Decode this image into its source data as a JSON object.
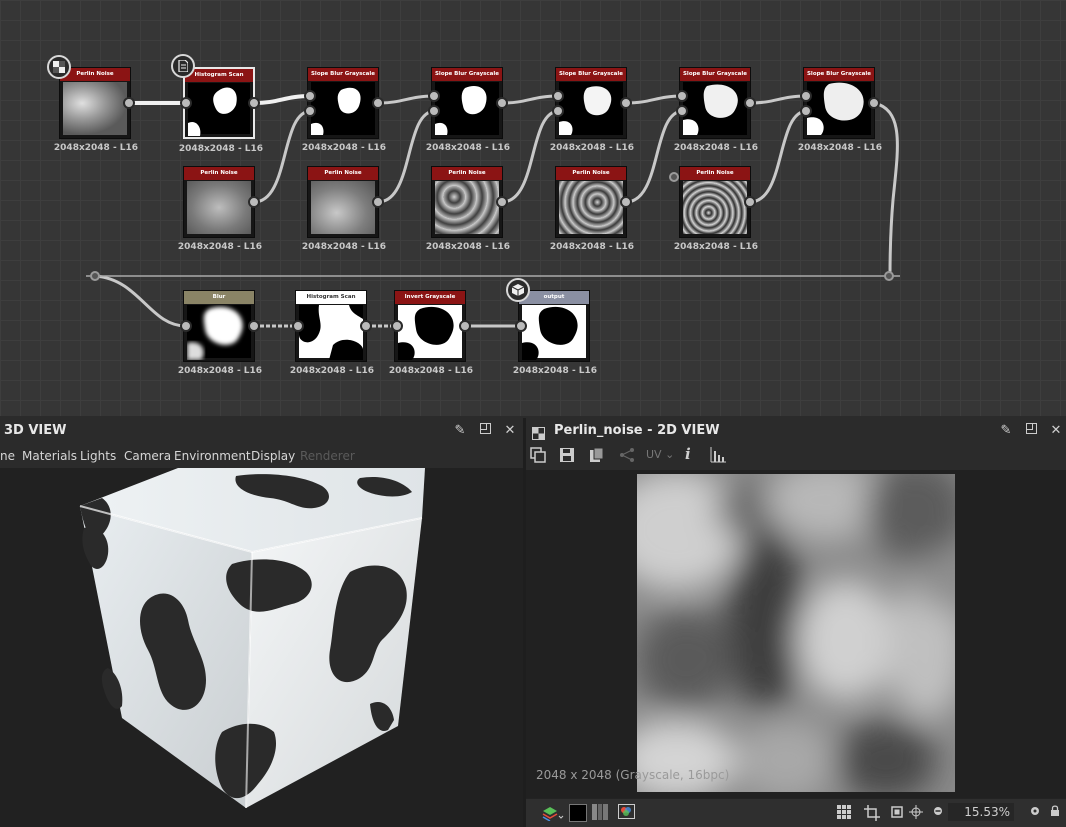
{
  "graph": {
    "res": "2048x2048 - L16",
    "nodes": {
      "perlin_main": "Perlin Noise",
      "hist1": "Histogram Scan",
      "slope1": "Slope Blur Grayscale",
      "slope2": "Slope Blur Grayscale",
      "slope3": "Slope Blur Grayscale",
      "slope4": "Slope Blur Grayscale",
      "slope5": "Slope Blur Grayscale",
      "perlin1": "Perlin Noise",
      "perlin2": "Perlin Noise",
      "perlin3": "Perlin Noise",
      "perlin4": "Perlin Noise",
      "perlin5": "Perlin Noise",
      "blur": "Blur",
      "hist2": "Histogram Scan",
      "invert": "Invert Grayscale",
      "output": "output"
    },
    "colors": {
      "header_red": "#8b1414",
      "header_blur": "#8a8466",
      "header_output": "#8a8fa2"
    }
  },
  "view3d": {
    "title": "3D VIEW",
    "menu": [
      "ne",
      "Materials",
      "Lights",
      "Camera",
      "Environment",
      "Display",
      "Renderer"
    ],
    "icons": [
      "pin-icon",
      "maximize-icon",
      "close-icon"
    ]
  },
  "view2d": {
    "title": "Perlin_noise - 2D VIEW",
    "toolbar_uv": "UV",
    "info": "i",
    "status": "2048 x 2048 (Grayscale, 16bpc)",
    "zoom": "15.53%"
  }
}
